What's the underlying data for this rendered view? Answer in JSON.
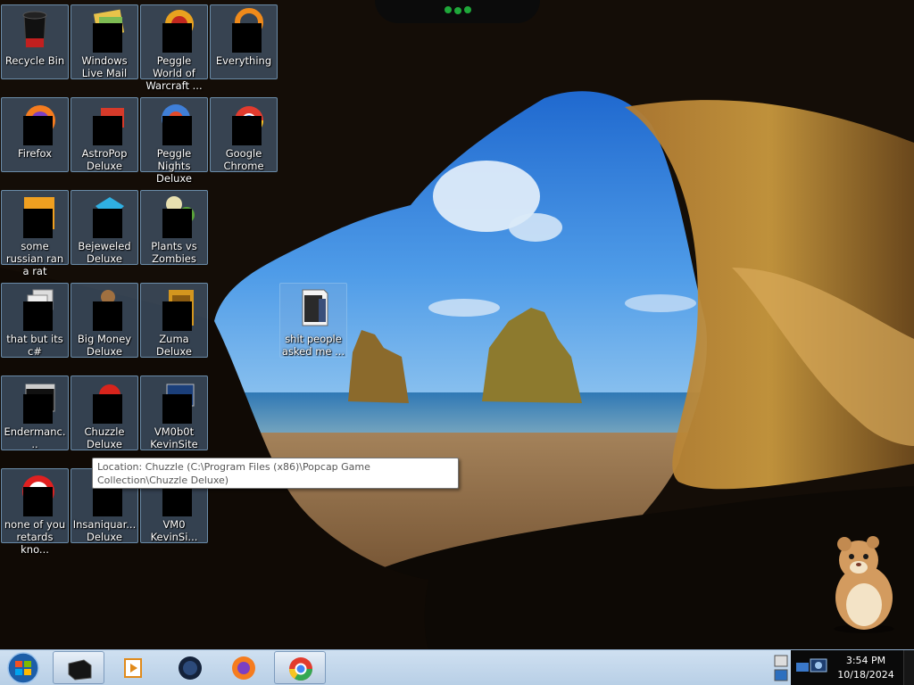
{
  "desktop": {
    "icons": [
      {
        "label": "Recycle Bin",
        "icon": "recycle-bin-icon"
      },
      {
        "label": "Windows Live Mail",
        "icon": "windows-live-mail-icon"
      },
      {
        "label": "Peggle World of Warcraft ...",
        "icon": "peggle-wow-icon"
      },
      {
        "label": "Everything",
        "icon": "everything-search-icon"
      },
      {
        "label": "Firefox",
        "icon": "firefox-icon"
      },
      {
        "label": "AstroPop Deluxe",
        "icon": "astropop-icon"
      },
      {
        "label": "Peggle Nights Deluxe",
        "icon": "peggle-nights-icon"
      },
      {
        "label": "Google Chrome",
        "icon": "chrome-icon"
      },
      {
        "label": "some russian ran a rat",
        "icon": "file-icon"
      },
      {
        "label": "Bejeweled Deluxe",
        "icon": "bejeweled-icon"
      },
      {
        "label": "Plants vs Zombies",
        "icon": "plants-vs-zombies-icon"
      },
      {
        "label": "that but its c#",
        "icon": "stacked-windows-icon"
      },
      {
        "label": "Big Money Deluxe",
        "icon": "big-money-icon"
      },
      {
        "label": "Zuma Deluxe",
        "icon": "zuma-icon"
      },
      {
        "label": "Endermanc...",
        "icon": "terminal-window-icon"
      },
      {
        "label": "Chuzzle Deluxe",
        "icon": "chuzzle-icon"
      },
      {
        "label": "VM0b0t KevinSite",
        "icon": "monitor-icon"
      },
      {
        "label": "none of you retards kno...",
        "icon": "red-circle-icon"
      },
      {
        "label": "Insaniquar... Deluxe",
        "icon": "insaniquarium-icon"
      },
      {
        "label": "VM0 KevinSi...",
        "icon": "monitor-icon"
      },
      {
        "label": "shit people asked me ...",
        "icon": "folder-icon"
      }
    ]
  },
  "tooltip": {
    "text": "Location: Chuzzle (C:\\Program Files (x86)\\Popcap Game Collection\\Chuzzle Deluxe)"
  },
  "taskbar": {
    "pinned": [
      {
        "name": "terminal",
        "icon": "black-window-icon",
        "active": true
      },
      {
        "name": "media-player",
        "icon": "media-player-icon",
        "active": false
      },
      {
        "name": "globe",
        "icon": "dark-globe-icon",
        "active": false
      },
      {
        "name": "firefox",
        "icon": "firefox-icon",
        "active": false
      },
      {
        "name": "chrome",
        "icon": "chrome-icon",
        "active": true
      }
    ],
    "clock": {
      "time": "3:54 PM",
      "date": "10/18/2024"
    }
  },
  "colors": {
    "taskbar": "#c4d8ec",
    "selection": "#78aadc",
    "wallpaper_sky": "#3f8fe0"
  }
}
